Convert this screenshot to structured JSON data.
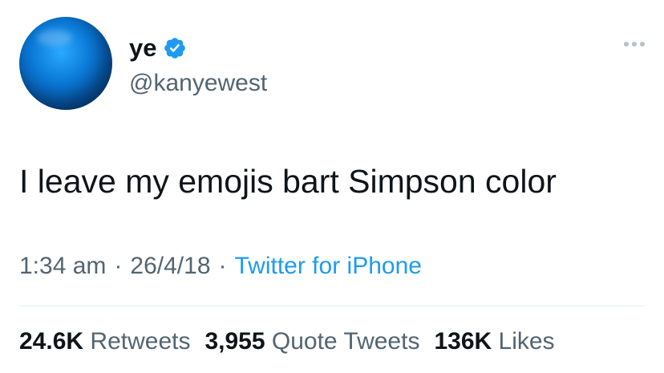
{
  "author": {
    "display_name": "ye",
    "handle": "@kanyewest",
    "verified": true
  },
  "tweet": {
    "text": "I leave my emojis bart Simpson color",
    "time": "1:34 am",
    "separator": "·",
    "date": "26/4/18",
    "source": "Twitter for iPhone"
  },
  "stats": {
    "retweets_count": "24.6K",
    "retweets_label": "Retweets",
    "quotes_count": "3,955",
    "quotes_label": "Quote Tweets",
    "likes_count": "136K",
    "likes_label": "Likes"
  },
  "colors": {
    "link": "#1d9bf0",
    "secondary_text": "#536471",
    "primary_text": "#0f1419",
    "avatar": "#0b7ad8"
  },
  "icons": {
    "verified": "verified-badge-icon",
    "more": "more-options-icon"
  }
}
